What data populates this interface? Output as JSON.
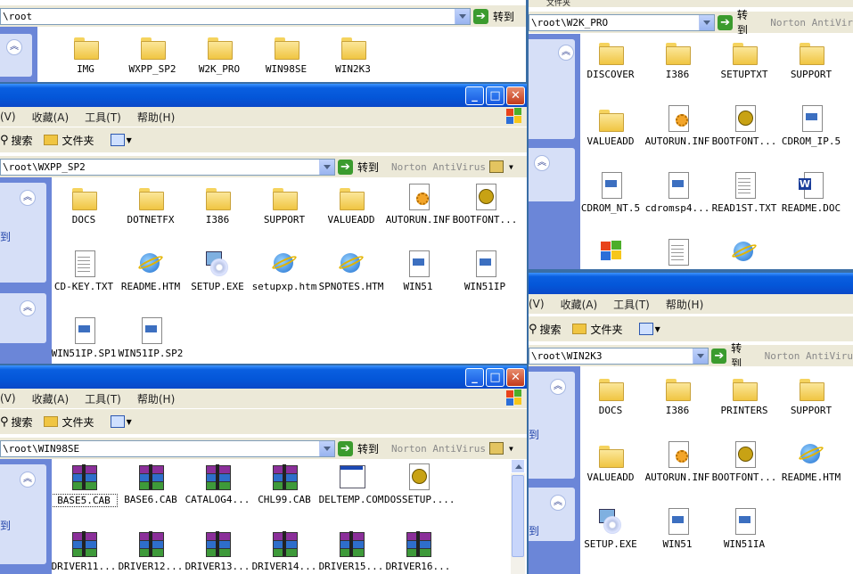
{
  "windows": {
    "root": {
      "address": "\\root",
      "go_label": "转到",
      "items": [
        {
          "label": "IMG",
          "icon": "folder"
        },
        {
          "label": "WXPP_SP2",
          "icon": "folder"
        },
        {
          "label": "W2K_PRO",
          "icon": "folder"
        },
        {
          "label": "WIN98SE",
          "icon": "folder"
        },
        {
          "label": "WIN2K3",
          "icon": "folder"
        }
      ]
    },
    "wxpp": {
      "menu": [
        "(V)",
        "收藏(A)",
        "工具(T)",
        "帮助(H)"
      ],
      "toolbar": {
        "search": "搜索",
        "folders": "文件夹"
      },
      "address": "\\root\\WXPP_SP2",
      "go_label": "转到",
      "norton": "Norton AntiVirus",
      "items": [
        {
          "label": "DOCS",
          "icon": "folder"
        },
        {
          "label": "DOTNETFX",
          "icon": "folder"
        },
        {
          "label": "I386",
          "icon": "folder"
        },
        {
          "label": "SUPPORT",
          "icon": "folder"
        },
        {
          "label": "VALUEADD",
          "icon": "folder"
        },
        {
          "label": "AUTORUN.INF",
          "icon": "gear"
        },
        {
          "label": "BOOTFONT...",
          "icon": "boot"
        },
        {
          "label": "CD-KEY.TXT",
          "icon": "doc"
        },
        {
          "label": "README.HTM",
          "icon": "ie"
        },
        {
          "label": "SETUP.EXE",
          "icon": "setup"
        },
        {
          "label": "setupxp.htm",
          "icon": "ie"
        },
        {
          "label": "SPNOTES.HTM",
          "icon": "ie"
        },
        {
          "label": "WIN51",
          "icon": "sys"
        },
        {
          "label": "WIN51IP",
          "icon": "sys"
        },
        {
          "label": "WIN51IP.SP1",
          "icon": "sys"
        },
        {
          "label": "WIN51IP.SP2",
          "icon": "sys"
        }
      ]
    },
    "win98": {
      "menu": [
        "(V)",
        "收藏(A)",
        "工具(T)",
        "帮助(H)"
      ],
      "toolbar": {
        "search": "搜索",
        "folders": "文件夹"
      },
      "address": "\\root\\WIN98SE",
      "go_label": "转到",
      "norton": "Norton AntiVirus",
      "items": [
        {
          "label": "BASE5.CAB",
          "icon": "cab"
        },
        {
          "label": "BASE6.CAB",
          "icon": "cab"
        },
        {
          "label": "CATALOG4...",
          "icon": "cab"
        },
        {
          "label": "CHL99.CAB",
          "icon": "cab"
        },
        {
          "label": "DELTEMP.COM",
          "icon": "com"
        },
        {
          "label": "DOSSETUP....",
          "icon": "boot"
        },
        {
          "label": "DRIVER11...",
          "icon": "cab"
        },
        {
          "label": "DRIVER12...",
          "icon": "cab"
        },
        {
          "label": "DRIVER13...",
          "icon": "cab"
        },
        {
          "label": "DRIVER14...",
          "icon": "cab"
        },
        {
          "label": "DRIVER15...",
          "icon": "cab"
        },
        {
          "label": "DRIVER16...",
          "icon": "cab"
        }
      ]
    },
    "w2k": {
      "address": "\\root\\W2K_PRO",
      "go_label": "转到",
      "norton": "Norton AntiVir",
      "items": [
        {
          "label": "DISCOVER",
          "icon": "folder"
        },
        {
          "label": "I386",
          "icon": "folder"
        },
        {
          "label": "SETUPTXT",
          "icon": "folder"
        },
        {
          "label": "SUPPORT",
          "icon": "folder"
        },
        {
          "label": "VALUEADD",
          "icon": "folder"
        },
        {
          "label": "AUTORUN.INF",
          "icon": "gear"
        },
        {
          "label": "BOOTFONT...",
          "icon": "boot"
        },
        {
          "label": "CDROM_IP.5",
          "icon": "sys"
        },
        {
          "label": "CDROM_NT.5",
          "icon": "sys"
        },
        {
          "label": "cdromsp4...",
          "icon": "sys"
        },
        {
          "label": "READ1ST.TXT",
          "icon": "doc"
        },
        {
          "label": "README.DOC",
          "icon": "word"
        },
        {
          "label": "",
          "icon": "winlogo"
        },
        {
          "label": "",
          "icon": "doc"
        },
        {
          "label": "",
          "icon": "ie"
        }
      ]
    },
    "win2k3": {
      "menu": [
        "(V)",
        "收藏(A)",
        "工具(T)",
        "帮助(H)"
      ],
      "toolbar": {
        "search": "搜索",
        "folders": "文件夹"
      },
      "address": "\\root\\WIN2K3",
      "go_label": "转到",
      "norton": "Norton AntiViru",
      "items": [
        {
          "label": "DOCS",
          "icon": "folder"
        },
        {
          "label": "I386",
          "icon": "folder"
        },
        {
          "label": "PRINTERS",
          "icon": "folder"
        },
        {
          "label": "SUPPORT",
          "icon": "folder"
        },
        {
          "label": "VALUEADD",
          "icon": "folder"
        },
        {
          "label": "AUTORUN.INF",
          "icon": "gear"
        },
        {
          "label": "BOOTFONT...",
          "icon": "boot"
        },
        {
          "label": "README.HTM",
          "icon": "ie"
        },
        {
          "label": "SETUP.EXE",
          "icon": "setup"
        },
        {
          "label": "WIN51",
          "icon": "sys"
        },
        {
          "label": "WIN51IA",
          "icon": "sys"
        }
      ]
    },
    "w2k_partial_top": {
      "menu_partial": "文件夹"
    },
    "side_text": "到"
  }
}
